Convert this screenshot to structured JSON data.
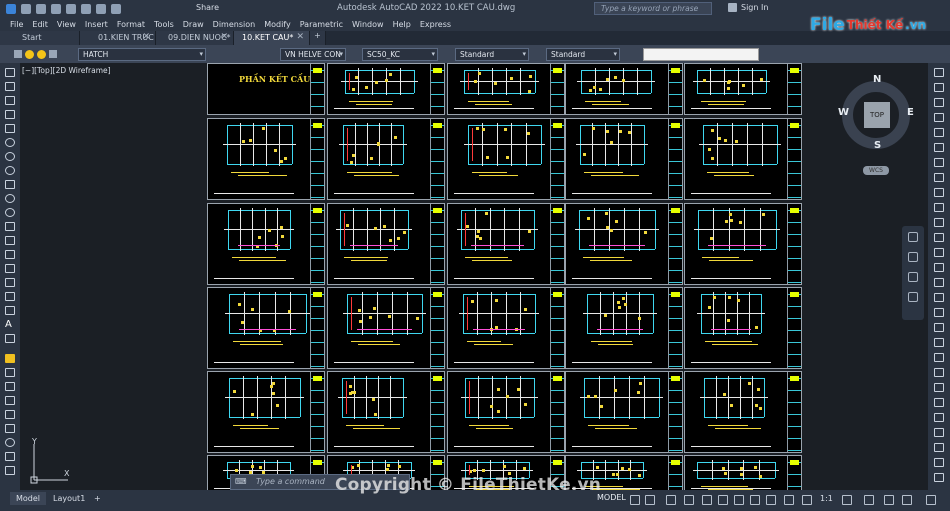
{
  "app": {
    "title": "Autodesk AutoCAD 2022    10.KET CAU.dwg",
    "share_label": "Share",
    "search_placeholder": "Type a keyword or phrase",
    "signin_label": "Sign In"
  },
  "menu": [
    "File",
    "Edit",
    "View",
    "Insert",
    "Format",
    "Tools",
    "Draw",
    "Dimension",
    "Modify",
    "Parametric",
    "Window",
    "Help",
    "Express"
  ],
  "tabs": [
    {
      "label": "Start",
      "active": false,
      "closable": false
    },
    {
      "label": "01.KIEN TRUC",
      "active": false,
      "closable": true
    },
    {
      "label": "09.DIEN NUOC*",
      "active": false,
      "closable": true
    },
    {
      "label": "10.KET CAU*",
      "active": true,
      "closable": true
    }
  ],
  "properties": {
    "hatch_combo": "HATCH",
    "textstyle_combo": "VN HELVE CON",
    "dimstyle_combo": "SC50_KC",
    "tablestyle_combo": "Standard",
    "mleaderstyle_combo": "Standard"
  },
  "viewport": {
    "label": "[−][Top][2D Wireframe]",
    "title_sheet_label": "PHẦN KẾT CẤU"
  },
  "viewcube": {
    "north": "N",
    "south": "S",
    "east": "E",
    "west": "W",
    "face": "TOP",
    "wcs": "WCS"
  },
  "ucs": {
    "x": "X",
    "y": "Y"
  },
  "command": {
    "placeholder": "Type a command"
  },
  "status": {
    "layout_tabs": [
      "Model",
      "Layout1"
    ],
    "model_label": "MODEL",
    "scale": "1:1"
  },
  "watermarks": {
    "logo_part1": "File",
    "logo_part2": "Thiết Kế",
    "logo_part3": ".vn",
    "copyright": "Copyright © FileThietKe.vn"
  },
  "colors": {
    "accent": "#3b84d9",
    "sheet_border": "#9aa3ad",
    "cad_yellow": "#f1d83b",
    "cad_cyan": "#3fd7f0"
  }
}
